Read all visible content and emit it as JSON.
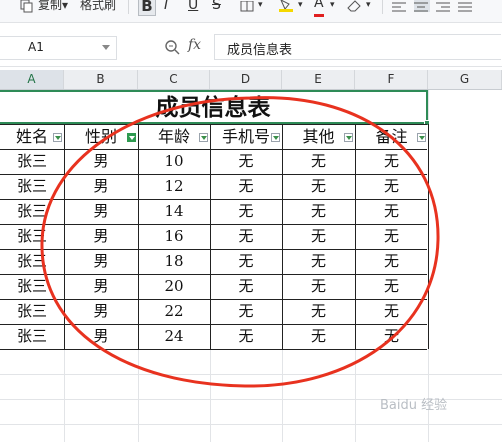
{
  "ribbon": {
    "copy_label": "复制",
    "format_painter_label": "格式刷",
    "bold_label": "B",
    "italic_label": "I",
    "underline_label": "U",
    "strike_label": "S",
    "font_color_label": "A"
  },
  "formula_bar": {
    "name_box": "A1",
    "fx_label": "fx",
    "formula": "成员信息表"
  },
  "columns": [
    "A",
    "B",
    "C",
    "D",
    "E",
    "F",
    "G"
  ],
  "selected_column": "A",
  "sheet": {
    "title": "成员信息表",
    "headers": [
      "姓名",
      "性别",
      "年龄",
      "手机号",
      "其他",
      "备注"
    ],
    "rows": [
      [
        "张三",
        "男",
        "10",
        "无",
        "无",
        "无"
      ],
      [
        "张三",
        "男",
        "12",
        "无",
        "无",
        "无"
      ],
      [
        "张三",
        "男",
        "14",
        "无",
        "无",
        "无"
      ],
      [
        "张三",
        "男",
        "16",
        "无",
        "无",
        "无"
      ],
      [
        "张三",
        "男",
        "18",
        "无",
        "无",
        "无"
      ],
      [
        "张三",
        "男",
        "20",
        "无",
        "无",
        "无"
      ],
      [
        "张三",
        "男",
        "22",
        "无",
        "无",
        "无"
      ],
      [
        "张三",
        "男",
        "24",
        "无",
        "无",
        "无"
      ]
    ],
    "active_filter_column": "性别"
  },
  "annotation_color": "#e8321f",
  "accent_color": "#2e8b57",
  "watermark": "Baidu 经验"
}
